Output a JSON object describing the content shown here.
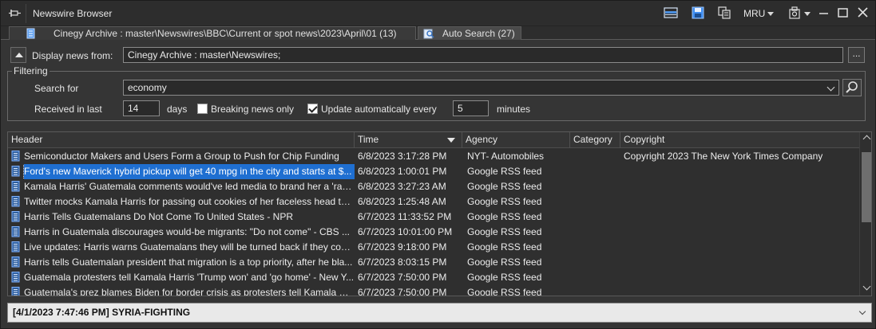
{
  "window": {
    "title": "Newswire Browser",
    "mru_label": "MRU"
  },
  "tabs": [
    {
      "label": "Cinegy Archive : master\\Newswires\\BBC\\Current or spot news\\2023\\April\\01 (13)",
      "active": false
    },
    {
      "label": "Auto Search (27)",
      "active": true
    }
  ],
  "source": {
    "label": "Display news from:",
    "value": "Cinegy Archive : master\\Newswires;",
    "browse_label": "..."
  },
  "filtering": {
    "title": "Filtering",
    "search_label": "Search for",
    "search_value": "economy",
    "received_label": "Received in last",
    "received_value": "14",
    "days_label": "days",
    "breaking_label": "Breaking news only",
    "breaking_checked": false,
    "auto_update_label": "Update automatically every",
    "auto_update_checked": true,
    "interval_value": "5",
    "minutes_label": "minutes"
  },
  "grid": {
    "columns": [
      "Header",
      "Time",
      "Agency",
      "Category",
      "Copyright"
    ],
    "sorted_column": "Time",
    "selected_row": 1,
    "rows": [
      {
        "header": "Semiconductor Makers and Users Form a Group to Push for Chip Funding",
        "time": "6/8/2023 3:17:28 PM",
        "agency": "NYT- Automobiles",
        "category": "",
        "copyright": "Copyright 2023 The New York Times Company"
      },
      {
        "header": "Ford's new Maverick hybrid pickup will get 40 mpg in the city and starts at $...",
        "time": "6/8/2023 1:00:01 PM",
        "agency": "Google RSS feed",
        "category": "",
        "copyright": ""
      },
      {
        "header": "Kamala Harris' Guatemala comments would've led media to brand her a 'rac...",
        "time": "6/8/2023 3:27:23 AM",
        "agency": "Google RSS feed",
        "category": "",
        "copyright": ""
      },
      {
        "header": "Twitter mocks Kamala Harris for passing out cookies of her faceless head to r...",
        "time": "6/8/2023 1:25:48 AM",
        "agency": "Google RSS feed",
        "category": "",
        "copyright": ""
      },
      {
        "header": "Harris Tells Guatemalans Do Not Come To United States - NPR",
        "time": "6/7/2023 11:33:52 PM",
        "agency": "Google RSS feed",
        "category": "",
        "copyright": ""
      },
      {
        "header": "Harris in Guatemala discourages would-be migrants: \"Do not come\" - CBS ...",
        "time": "6/7/2023 10:01:00 PM",
        "agency": "Google RSS feed",
        "category": "",
        "copyright": ""
      },
      {
        "header": "Live updates: Harris warns Guatemalans they will be turned back if they com...",
        "time": "6/7/2023 9:18:00 PM",
        "agency": "Google RSS feed",
        "category": "",
        "copyright": ""
      },
      {
        "header": "Harris tells Guatemalan president that migration is a top priority, after he bla...",
        "time": "6/7/2023 8:03:15 PM",
        "agency": "Google RSS feed",
        "category": "",
        "copyright": ""
      },
      {
        "header": "Guatemala protesters tell Kamala Harris 'Trump won' and 'go home' - New Y...",
        "time": "6/7/2023 7:50:00 PM",
        "agency": "Google RSS feed",
        "category": "",
        "copyright": ""
      },
      {
        "header": "Guatemala's prez blames Biden for border crisis as protesters tell Kamala Har...",
        "time": "6/7/2023 7:50:00 PM",
        "agency": "Google RSS feed",
        "category": "",
        "copyright": ""
      }
    ]
  },
  "bottom": {
    "value": "[4/1/2023 7:47:46 PM] SYRIA-FIGHTING"
  },
  "colors": {
    "selection": "#1f6fd1",
    "doc_icon": "#7fb2ff",
    "save_icon": "#3f8df0"
  },
  "icons": [
    "pin-icon",
    "layout-icon",
    "save-icon",
    "copy-icon",
    "settings-icon",
    "minimize-icon",
    "maximize-icon",
    "close-icon",
    "archive-icon",
    "search-icon",
    "document-icon"
  ]
}
